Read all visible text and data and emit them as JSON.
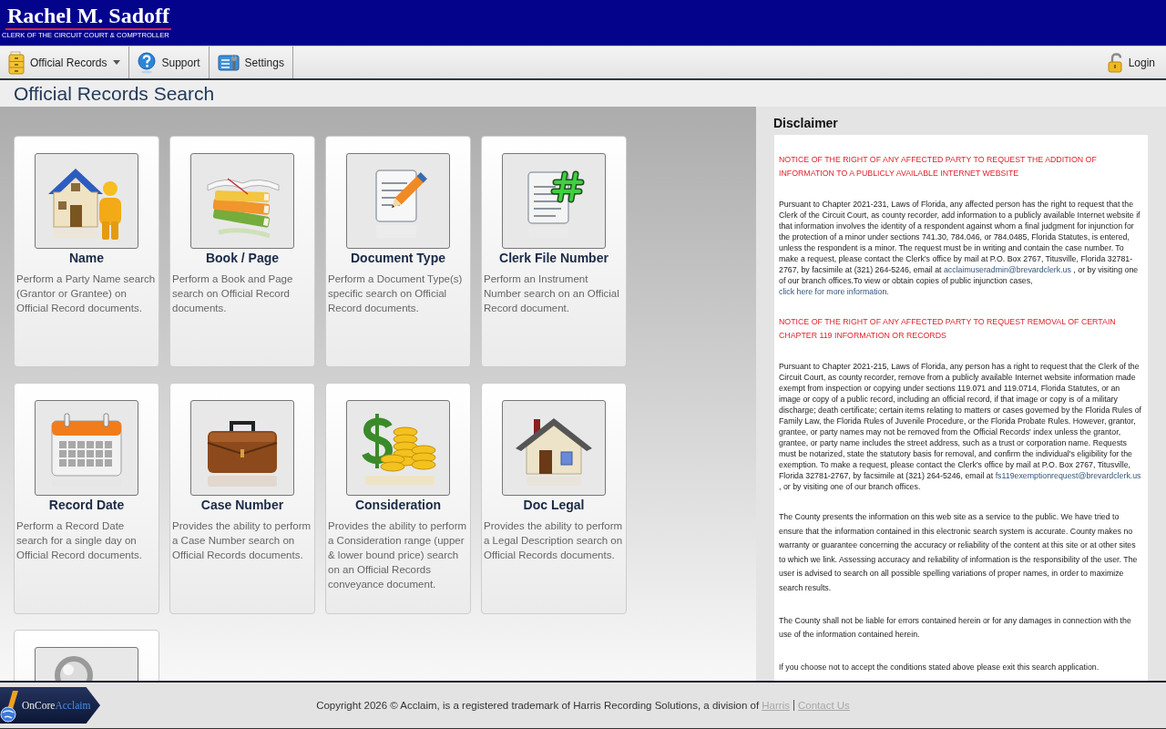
{
  "header": {
    "title": "Rachel M. Sadoff",
    "subtitle": "CLERK OF THE CIRCUIT COURT & COMPTROLLER"
  },
  "menu": {
    "items": [
      {
        "label": "Official Records",
        "has_dropdown": true
      },
      {
        "label": "Support",
        "has_dropdown": false
      },
      {
        "label": "Settings",
        "has_dropdown": false
      }
    ],
    "login": {
      "label": "Login"
    }
  },
  "page_title": "Official Records Search",
  "search_cards": [
    {
      "kind": "name",
      "title": "Name",
      "description": "Perform a Party Name search (Grantor or Grantee) on Official Record documents."
    },
    {
      "kind": "bookpage",
      "title": "Book / Page",
      "description": "Perform a Book and Page search on Official Record documents."
    },
    {
      "kind": "doctype",
      "title": "Document Type",
      "description": "Perform a Document Type(s) specific search on Official Record documents."
    },
    {
      "kind": "clerkfile",
      "title": "Clerk File Number",
      "description": "Perform an Instrument Number search on an Official Record document."
    },
    {
      "kind": "recorddate",
      "title": "Record Date",
      "description": "Perform a Record Date search for a single day on Official Record documents."
    },
    {
      "kind": "casenumber",
      "title": "Case Number",
      "description": "Provides the ability to perform a Case Number search on Official Records documents."
    },
    {
      "kind": "consideration",
      "title": "Consideration",
      "description": "Provides the ability to perform a Consideration range (upper & lower bound price) search on an Official Records conveyance document."
    },
    {
      "kind": "doclegal",
      "title": "Doc Legal",
      "description": "Provides the ability to perform a Legal Description search on Official Records documents."
    },
    {
      "kind": "search"
    }
  ],
  "disclaimer": {
    "title": "Disclaimer",
    "blocks": [
      {
        "kind": "notice",
        "segments": [
          {
            "kind": "text",
            "text": "NOTICE OF THE RIGHT OF ANY AFFECTED PARTY TO REQUEST THE ADDITION OF INFORMATION TO A PUBLICLY AVAILABLE INTERNET WEBSITE"
          }
        ]
      },
      {
        "kind": "statute",
        "segments": [
          {
            "kind": "text",
            "text": "Pursuant to Chapter 2021-231, Laws of Florida, any affected person has the right to request that the Clerk of the Circuit Court, as county recorder, add information to a publicly available Internet website if that information involves the identity of a respondent against whom a final judgment for injunction for the protection of a minor under sections 741.30, 784.046, or 784.0485, Florida Statutes, is entered, unless the respondent is a minor. The request must be in writing and contain the case number. To make a request, please contact the Clerk's office by mail at P.O. Box 2767, Titusville, Florida 32781-2767, by facsimile at (321) 264-5246, email at "
          },
          {
            "kind": "email",
            "text": "acclaimuseradmin@brevardclerk.us"
          },
          {
            "kind": "text",
            "text": " , or by visiting one of our branch offices.To view or obtain copies of public injunction cases, "
          },
          {
            "kind": "link",
            "text": "click here for more information."
          }
        ]
      },
      {
        "kind": "notice",
        "segments": [
          {
            "kind": "text",
            "text": "NOTICE OF THE RIGHT OF ANY AFFECTED PARTY TO REQUEST REMOVAL OF CERTAIN CHAPTER 119 INFORMATION OR RECORDS"
          }
        ]
      },
      {
        "kind": "statute",
        "segments": [
          {
            "kind": "text",
            "text": "Pursuant to Chapter 2021-215, Laws of Florida, any person has a right to request that the Clerk of the Circuit Court, as county recorder, remove from a publicly available Internet website information made exempt from inspection or copying under sections 119.071 and 119.0714, Florida Statutes, or an image or copy of a public record, including an official record, if that image or copy is of a military discharge; death certificate; certain items relating to matters or cases governed by the Florida Rules of Family Law, the Florida Rules of Juvenile Procedure, or the Florida Probate Rules. However, grantor, grantee, or party names may not be removed from the Official Records' index unless the grantor, grantee, or party name includes the street address, such as a trust or corporation name. Requests must be notarized, state the statutory basis for removal, and confirm the individual's eligibility for the exemption. To make a request, please contact the Clerk's office by mail at P.O. Box 2767, Titusville, Florida 32781-2767, by facsimile at (321) 264-5246, email at "
          },
          {
            "kind": "email",
            "text": "fs119exemptionrequest@brevardclerk.us"
          },
          {
            "kind": "text",
            "text": " , or by visiting one of our branch offices."
          }
        ]
      },
      {
        "kind": "paragraph",
        "segments": [
          {
            "kind": "text",
            "text": "The County presents the information on this web site as a service to the public. We have tried to ensure that the information contained in this electronic search system is accurate. County makes no warranty or guarantee concerning the accuracy or reliability of the content at this site or at other sites to which we link. Assessing accuracy and reliability of information is the responsibility of the user. The user is advised to search on all possible spelling variations of proper names, in order to maximize search results."
          }
        ]
      },
      {
        "kind": "paragraph",
        "segments": [
          {
            "kind": "text",
            "text": "The County shall not be liable for errors contained herein or for any damages in connection with the use of the information contained herein."
          }
        ]
      },
      {
        "kind": "paragraph",
        "segments": [
          {
            "kind": "text",
            "text": "If you choose not to accept the conditions stated above please exit this search application."
          }
        ]
      }
    ]
  },
  "footer": {
    "logo": {
      "prefix": "OnCore",
      "name": "Acclaim"
    },
    "copyright": "Copyright 2026 © Acclaim, is a registered trademark of Harris Recording Solutions, a division of",
    "links": [
      "Harris",
      "Contact Us"
    ]
  }
}
